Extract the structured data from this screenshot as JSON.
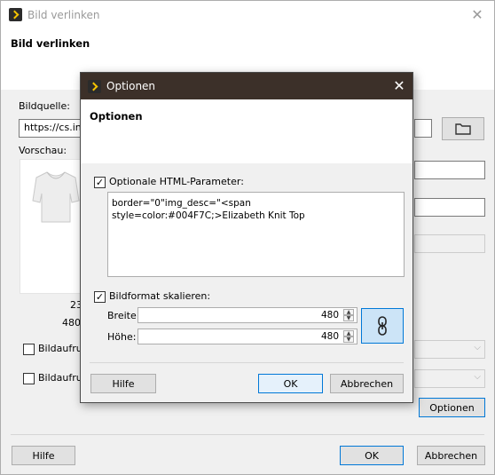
{
  "main": {
    "window_title": "Bild verlinken",
    "header_title": "Bild verlinken",
    "source_label": "Bildquelle:",
    "source_value": "https://cs.inxs",
    "preview_label": "Vorschau:",
    "preview_number": "23",
    "preview_size": "480x",
    "checkbox1_label": "Bildaufruf",
    "checkbox2_label": "Bildaufruf",
    "options_button": "Optionen",
    "help_button": "Hilfe",
    "ok_button": "OK",
    "cancel_button": "Abbrechen"
  },
  "dialog": {
    "window_title": "Optionen",
    "header_title": "Optionen",
    "html_params_label": "Optionale HTML-Parameter:",
    "html_params_checked": true,
    "html_params_value": "border=\"0\"img_desc=\"<span style=color:#004F7C;>Elizabeth Knit Top",
    "scale_label": "Bildformat skalieren:",
    "scale_checked": true,
    "width_label": "Breite:",
    "width_value": "480",
    "height_label": "Höhe:",
    "height_value": "480",
    "help_button": "Hilfe",
    "ok_button": "OK",
    "cancel_button": "Abbrechen"
  },
  "icons": {
    "app_logo": "inxmail-logo-icon",
    "close": "close-icon",
    "folder": "folder-icon",
    "chain": "chain-link-icon",
    "dropdown": "chevron-down-icon"
  },
  "colors": {
    "dialog_titlebar": "#3c3029",
    "accent": "#0078d7",
    "logo_yellow": "#f5c400"
  }
}
